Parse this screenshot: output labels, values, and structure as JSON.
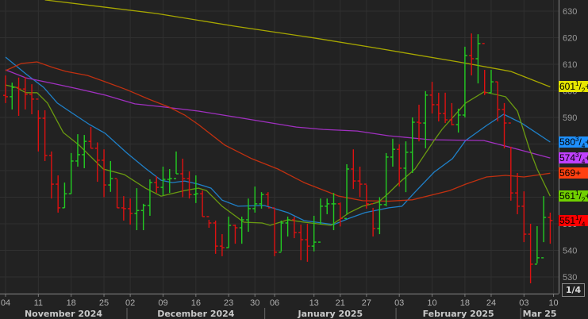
{
  "chart_data": {
    "type": "ohlc",
    "title": "",
    "xlabel": "",
    "ylabel": "",
    "ylim": [
      526,
      634
    ],
    "y_ticks": [
      530,
      540,
      550,
      560,
      570,
      580,
      590,
      600,
      610,
      620,
      630
    ],
    "grid": true,
    "background": "#222222",
    "bar_colors": {
      "up": "#22cc22",
      "down": "#dd1111"
    },
    "x_ticks": [
      {
        "label": "04",
        "bar_index": 0
      },
      {
        "label": "11",
        "bar_index": 5
      },
      {
        "label": "18",
        "bar_index": 10
      },
      {
        "label": "25",
        "bar_index": 15
      },
      {
        "label": "02",
        "bar_index": 19
      },
      {
        "label": "09",
        "bar_index": 24
      },
      {
        "label": "16",
        "bar_index": 29
      },
      {
        "label": "23",
        "bar_index": 34
      },
      {
        "label": "30",
        "bar_index": 38
      },
      {
        "label": "06",
        "bar_index": 41
      },
      {
        "label": "13",
        "bar_index": 47
      },
      {
        "label": "21",
        "bar_index": 51
      },
      {
        "label": "27",
        "bar_index": 55
      },
      {
        "label": "03",
        "bar_index": 60
      },
      {
        "label": "10",
        "bar_index": 65
      },
      {
        "label": "18",
        "bar_index": 70
      },
      {
        "label": "24",
        "bar_index": 74
      },
      {
        "label": "03",
        "bar_index": 79
      },
      {
        "label": "10",
        "bar_index": 83.5
      }
    ],
    "months": [
      {
        "label": "November 2024",
        "start_index": -1,
        "end_index": 18.5
      },
      {
        "label": "December 2024",
        "start_index": 18.5,
        "end_index": 39.5
      },
      {
        "label": "January 2025",
        "start_index": 39.5,
        "end_index": 59.5
      },
      {
        "label": "February 2025",
        "start_index": 59.5,
        "end_index": 78.5
      },
      {
        "label": "Mar 25",
        "start_index": 78.5,
        "end_index": 84.5
      }
    ],
    "bars_hlc": [
      [
        605.8,
        595.4,
        597.8
      ],
      [
        603.1,
        593,
        601.3
      ],
      [
        605,
        590.6,
        600.7
      ],
      [
        605.2,
        593,
        598.7
      ],
      [
        602.5,
        591.2,
        596.9
      ],
      [
        592.7,
        577.2,
        589.7
      ],
      [
        592.7,
        573.6,
        575.7
      ],
      [
        577.2,
        559.5,
        564.9
      ],
      [
        568.2,
        554.2,
        556
      ],
      [
        565.5,
        556,
        561.3
      ],
      [
        576.6,
        561.3,
        573.6
      ],
      [
        583.7,
        571.5,
        576
      ],
      [
        583.4,
        570.9,
        581
      ],
      [
        586.4,
        578.4,
        578.4
      ],
      [
        580.6,
        565.8,
        573.9
      ],
      [
        578,
        560,
        564.6
      ],
      [
        573.6,
        562,
        567
      ],
      [
        566.7,
        556,
        556
      ],
      [
        560.4,
        551.2,
        555.7
      ],
      [
        559.5,
        549.7,
        553.9
      ],
      [
        563.4,
        547.6,
        555
      ],
      [
        557.5,
        547.6,
        556.9
      ],
      [
        566.7,
        553,
        565.5
      ],
      [
        567.9,
        561.6,
        563.7
      ],
      [
        571.5,
        560.7,
        566.7
      ],
      [
        570.6,
        561.6,
        567
      ],
      [
        577.2,
        568.8,
        568.8
      ],
      [
        574.5,
        560,
        567
      ],
      [
        569.7,
        559.5,
        561
      ],
      [
        568.2,
        557.8,
        561.3
      ],
      [
        562.5,
        552.7,
        552.7
      ],
      [
        551.5,
        548.5,
        550.3
      ],
      [
        551.2,
        538.7,
        541.6
      ],
      [
        546.1,
        537.8,
        541
      ],
      [
        552.7,
        541,
        549.4
      ],
      [
        549.7,
        542.5,
        548.5
      ],
      [
        552.7,
        542.5,
        551.5
      ],
      [
        559.5,
        547,
        555.7
      ],
      [
        564,
        554.2,
        557.5
      ],
      [
        561.9,
        555.7,
        561
      ],
      [
        561.9,
        556.6,
        556
      ],
      [
        555.7,
        537.8,
        539.3
      ],
      [
        551.2,
        539.6,
        550.3
      ],
      [
        552.7,
        545.2,
        551.5
      ],
      [
        552.7,
        544.6,
        546.7
      ],
      [
        549.7,
        536.3,
        544
      ],
      [
        550,
        535.7,
        541.6
      ],
      [
        553,
        539.6,
        543.1
      ],
      [
        559.5,
        549.7,
        556.6
      ],
      [
        559.5,
        553.6,
        557.5
      ],
      [
        561.6,
        547.6,
        557.5
      ],
      [
        558,
        549,
        552
      ],
      [
        572.4,
        553.6,
        570.6
      ],
      [
        578,
        563.1,
        566.1
      ],
      [
        571.5,
        560,
        564.9
      ],
      [
        564.6,
        555.7,
        557.5
      ],
      [
        556,
        545.2,
        548.2
      ],
      [
        560,
        546.1,
        557.2
      ],
      [
        576.6,
        556.6,
        575.1
      ],
      [
        582,
        571.5,
        578
      ],
      [
        579.9,
        564,
        570.9
      ],
      [
        581,
        561.9,
        576.9
      ],
      [
        590,
        569.1,
        588.2
      ],
      [
        594.8,
        581,
        587.9
      ],
      [
        599.9,
        578.4,
        598.4
      ],
      [
        603.4,
        591.5,
        594.8
      ],
      [
        599.3,
        588.5,
        591.5
      ],
      [
        599.3,
        587.9,
        589.1
      ],
      [
        595.4,
        587,
        587.3
      ],
      [
        593.3,
        584.3,
        590.9
      ],
      [
        616.6,
        590,
        613.3
      ],
      [
        621.6,
        605.8,
        612.1
      ],
      [
        621.3,
        602.8,
        617.8
      ],
      [
        607.9,
        598.4,
        599.3
      ],
      [
        607.9,
        599.3,
        603.4
      ],
      [
        603.4,
        588.5,
        593
      ],
      [
        595.4,
        578.4,
        587.9
      ],
      [
        579,
        558.7,
        561.6
      ],
      [
        569.1,
        553.6,
        556.6
      ],
      [
        562.2,
        543.1,
        546.1
      ],
      [
        550,
        527.6,
        534.8
      ],
      [
        549.1,
        535.1,
        537.2
      ],
      [
        560.4,
        543.1,
        552.4
      ],
      [
        554.2,
        542.5,
        551.25
      ]
    ],
    "series": [
      {
        "color": "#a8a800",
        "label_bg": "#e6e600",
        "last": {
          "int": "601",
          "num": "1",
          "den": "2",
          "suffix": "+"
        },
        "points": [
          [
            6,
            634.2
          ],
          [
            23,
            629.1
          ],
          [
            35,
            624.3
          ],
          [
            47,
            619.9
          ],
          [
            56,
            616.3
          ],
          [
            69,
            610.9
          ],
          [
            77,
            607.3
          ],
          [
            83,
            601.5
          ]
        ]
      },
      {
        "color": "#1f80c8",
        "label_bg": "#1e90ff",
        "last": {
          "int": "580",
          "num": "3",
          "den": "4",
          "suffix": "+"
        },
        "points": [
          [
            0,
            612.7
          ],
          [
            3.1,
            606.4
          ],
          [
            5.8,
            601.3
          ],
          [
            7.9,
            595.4
          ],
          [
            9.7,
            592.4
          ],
          [
            12.8,
            587.3
          ],
          [
            15.2,
            584
          ],
          [
            18.5,
            576.6
          ],
          [
            21.3,
            570.9
          ],
          [
            23.7,
            566.4
          ],
          [
            25.4,
            565.5
          ],
          [
            27.3,
            566.1
          ],
          [
            29.4,
            564.9
          ],
          [
            31.3,
            563.4
          ],
          [
            33,
            558.9
          ],
          [
            35.4,
            556.6
          ],
          [
            39.4,
            556.9
          ],
          [
            43,
            554.2
          ],
          [
            45.5,
            551.2
          ],
          [
            50,
            549.7
          ],
          [
            52.4,
            552.1
          ],
          [
            54.8,
            554.2
          ],
          [
            58.4,
            556
          ],
          [
            60.4,
            556.6
          ],
          [
            62.4,
            561.9
          ],
          [
            65.3,
            569.4
          ],
          [
            68.1,
            574.5
          ],
          [
            70.1,
            581.3
          ],
          [
            73.3,
            587
          ],
          [
            75.9,
            591.2
          ],
          [
            78.6,
            587.9
          ],
          [
            81,
            584
          ],
          [
            83,
            580.75
          ]
        ]
      },
      {
        "color": "#a030c0",
        "label_bg": "#c040ff",
        "last": {
          "int": "574",
          "num": "3",
          "den": "4",
          "suffix": "+"
        },
        "points": [
          [
            0,
            607.9
          ],
          [
            3.1,
            604.9
          ],
          [
            7.2,
            602.8
          ],
          [
            11.2,
            600.7
          ],
          [
            15.2,
            598.4
          ],
          [
            19.7,
            595.1
          ],
          [
            24.2,
            593.9
          ],
          [
            29.4,
            592.4
          ],
          [
            35.4,
            590
          ],
          [
            44.3,
            586.4
          ],
          [
            48.4,
            585.5
          ],
          [
            53.6,
            584.9
          ],
          [
            58.4,
            583.1
          ],
          [
            64.8,
            581.6
          ],
          [
            72.9,
            581.3
          ],
          [
            78.1,
            578
          ],
          [
            83,
            574.75
          ]
        ]
      },
      {
        "color": "#c03010",
        "label_bg": "#ff4010",
        "last": {
          "int": "569",
          "num": "",
          "den": "",
          "suffix": "+"
        },
        "points": [
          [
            0,
            607.6
          ],
          [
            2.4,
            610.3
          ],
          [
            4.8,
            610.9
          ],
          [
            7.2,
            608.8
          ],
          [
            9.2,
            607.3
          ],
          [
            12.5,
            605.8
          ],
          [
            15.2,
            603.4
          ],
          [
            18.5,
            600.4
          ],
          [
            21.8,
            596.9
          ],
          [
            24.9,
            593.9
          ],
          [
            27.3,
            590.9
          ],
          [
            29.4,
            587.3
          ],
          [
            33.4,
            579.6
          ],
          [
            37.5,
            574.5
          ],
          [
            41.5,
            570.6
          ],
          [
            45.5,
            565.5
          ],
          [
            50.8,
            560.4
          ],
          [
            54.4,
            558.7
          ],
          [
            58.4,
            558.5
          ],
          [
            62,
            559
          ],
          [
            67.7,
            562.5
          ],
          [
            70.1,
            564.9
          ],
          [
            73.3,
            567.6
          ],
          [
            76.2,
            568.2
          ],
          [
            79,
            567.6
          ],
          [
            83,
            569
          ]
        ]
      },
      {
        "color": "#6a9a10",
        "label_bg": "#70d000",
        "last": {
          "int": "561",
          "num": "1",
          "den": "2",
          "suffix": "+"
        },
        "points": [
          [
            0,
            602.2
          ],
          [
            1.6,
            601.3
          ],
          [
            3.1,
            599.3
          ],
          [
            4.8,
            599.3
          ],
          [
            6.4,
            595.4
          ],
          [
            8.8,
            584.3
          ],
          [
            11.2,
            579.6
          ],
          [
            14.9,
            570.6
          ],
          [
            18.1,
            568.5
          ],
          [
            21.3,
            563.4
          ],
          [
            23.7,
            560.4
          ],
          [
            27.3,
            562.5
          ],
          [
            29.4,
            563.4
          ],
          [
            30.6,
            562.5
          ],
          [
            33,
            556.6
          ],
          [
            36.3,
            550.6
          ],
          [
            39.1,
            550.3
          ],
          [
            40.3,
            549.4
          ],
          [
            43,
            551.5
          ],
          [
            45.5,
            550.6
          ],
          [
            49.6,
            549.4
          ],
          [
            52.4,
            554.2
          ],
          [
            54.4,
            556.6
          ],
          [
            56.8,
            558.1
          ],
          [
            58.4,
            561.6
          ],
          [
            60,
            565.5
          ],
          [
            62.4,
            570.6
          ],
          [
            65.3,
            581.3
          ],
          [
            66.5,
            585.5
          ],
          [
            70.1,
            595.4
          ],
          [
            72.9,
            599.6
          ],
          [
            76.2,
            597.8
          ],
          [
            78,
            592.4
          ],
          [
            79.8,
            578.4
          ],
          [
            81,
            570.6
          ],
          [
            83,
            560.4
          ]
        ]
      }
    ],
    "last_price": {
      "int": "551",
      "num": "1",
      "den": "4",
      "suffix": "",
      "label_bg": "#ff0000"
    }
  },
  "page_indicator": "1/4"
}
